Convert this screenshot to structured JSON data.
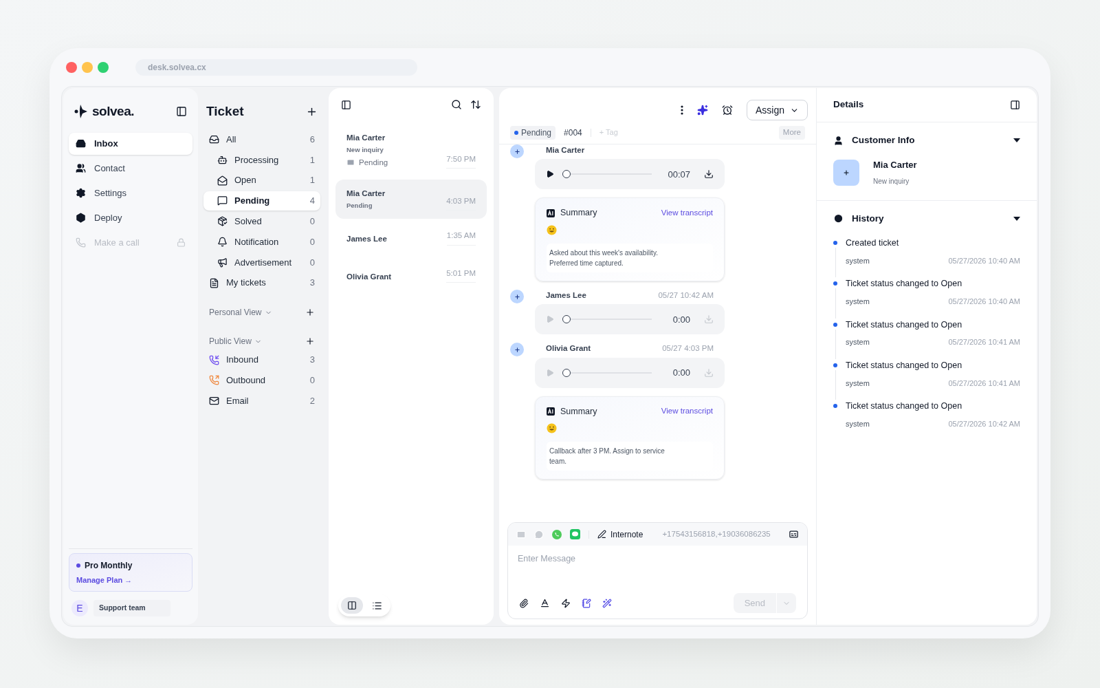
{
  "browser": {
    "url": "desk.solvea.cx"
  },
  "sidebar": {
    "logo": "solvea.",
    "items": [
      {
        "label": "Inbox",
        "selected": true,
        "disabled": false
      },
      {
        "label": "Contact",
        "selected": false,
        "disabled": false
      },
      {
        "label": "Settings",
        "selected": false,
        "disabled": false
      },
      {
        "label": "Deploy",
        "selected": false,
        "disabled": false
      },
      {
        "label": "Make a call",
        "selected": false,
        "disabled": true
      }
    ],
    "plan": {
      "name": "Pro Monthly",
      "link": "Manage Plan →"
    },
    "user": {
      "initial": "E",
      "name": "Support team"
    }
  },
  "ticket_nav": {
    "title": "Ticket",
    "items": [
      {
        "label": "All",
        "count": "6",
        "selected": false,
        "children": [
          {
            "label": "Processing",
            "count": "1",
            "selected": false
          },
          {
            "label": "Open",
            "count": "1",
            "selected": false
          },
          {
            "label": "Pending",
            "count": "4",
            "selected": true
          },
          {
            "label": "Solved",
            "count": "0",
            "selected": false
          },
          {
            "label": "Notification",
            "count": "0",
            "selected": false
          },
          {
            "label": "Advertisement",
            "count": "0",
            "selected": false
          }
        ]
      },
      {
        "label": "My tickets",
        "count": "3",
        "selected": false
      }
    ],
    "personal_view": {
      "label": "Personal View"
    },
    "public_view": {
      "label": "Public View",
      "items": [
        {
          "label": "Inbound",
          "count": "3",
          "selected": false
        },
        {
          "label": "Outbound",
          "count": "0",
          "selected": false
        },
        {
          "label": "Email",
          "count": "2",
          "selected": false
        }
      ]
    }
  },
  "ticket_list": {
    "items": [
      {
        "name": "Mia Carter",
        "subtitle": "New inquiry",
        "status": "Pending",
        "time": "7:50 PM",
        "selected": false
      },
      {
        "name": "Mia Carter",
        "subtitle": "Pending",
        "time": "4:03 PM",
        "selected": true
      },
      {
        "name": "James Lee",
        "time": "1:35 AM",
        "selected": false
      },
      {
        "name": "Olivia Grant",
        "time": "5:01 PM",
        "selected": false
      }
    ],
    "view_modes": [
      {
        "kind": "split",
        "selected": true
      },
      {
        "kind": "list",
        "selected": false
      }
    ]
  },
  "conversation": {
    "assign": "Assign",
    "status": "Pending",
    "ticket_id": "#004",
    "tag": "+ Tag",
    "more": "More",
    "messages": [
      {
        "kind": "call",
        "sender": "Mia Carter",
        "duration": "00:07",
        "playable": true
      },
      {
        "kind": "summary",
        "title": "Summary",
        "link": "View transcript",
        "text": "Asked about this week's availability.\nPreferred time captured."
      },
      {
        "kind": "call",
        "sender": "James Lee",
        "time": "05/27 10:42 AM",
        "duration": "0:00",
        "playable": false
      },
      {
        "kind": "call",
        "sender": "Olivia Grant",
        "time": "05/27 4:03 PM",
        "duration": "0:00",
        "playable": false
      },
      {
        "kind": "summary",
        "title": "Summary",
        "link": "View transcript",
        "text": "Callback after 3 PM. Assign to service\nteam."
      }
    ],
    "composer": {
      "channels": [
        {
          "kind": "email",
          "enabled": false
        },
        {
          "kind": "chat",
          "enabled": false
        },
        {
          "kind": "whatsapp",
          "enabled": true
        },
        {
          "kind": "sms",
          "enabled": true
        }
      ],
      "note": "Internote",
      "recipients": "+17543156818,+19036086235",
      "placeholder": "Enter Message",
      "send": "Send",
      "send_disabled": true
    }
  },
  "details": {
    "title": "Details",
    "customer": {
      "heading": "Customer Info",
      "expanded": true,
      "name": "Mia Carter",
      "subtitle": "New inquiry"
    },
    "history": {
      "heading": "History",
      "expanded": true,
      "events": [
        {
          "title": "Created ticket",
          "actor": "system",
          "time": "05/27/2026 10:40 AM"
        },
        {
          "title": "Ticket status changed to Open",
          "actor": "system",
          "time": "05/27/2026 10:40 AM"
        },
        {
          "title": "Ticket status changed to Open",
          "actor": "system",
          "time": "05/27/2026 10:41 AM"
        },
        {
          "title": "Ticket status changed to Open",
          "actor": "system",
          "time": "05/27/2026 10:41 AM"
        },
        {
          "title": "Ticket status changed to Open",
          "actor": "system",
          "time": "05/27/2026 10:42 AM"
        }
      ]
    }
  }
}
